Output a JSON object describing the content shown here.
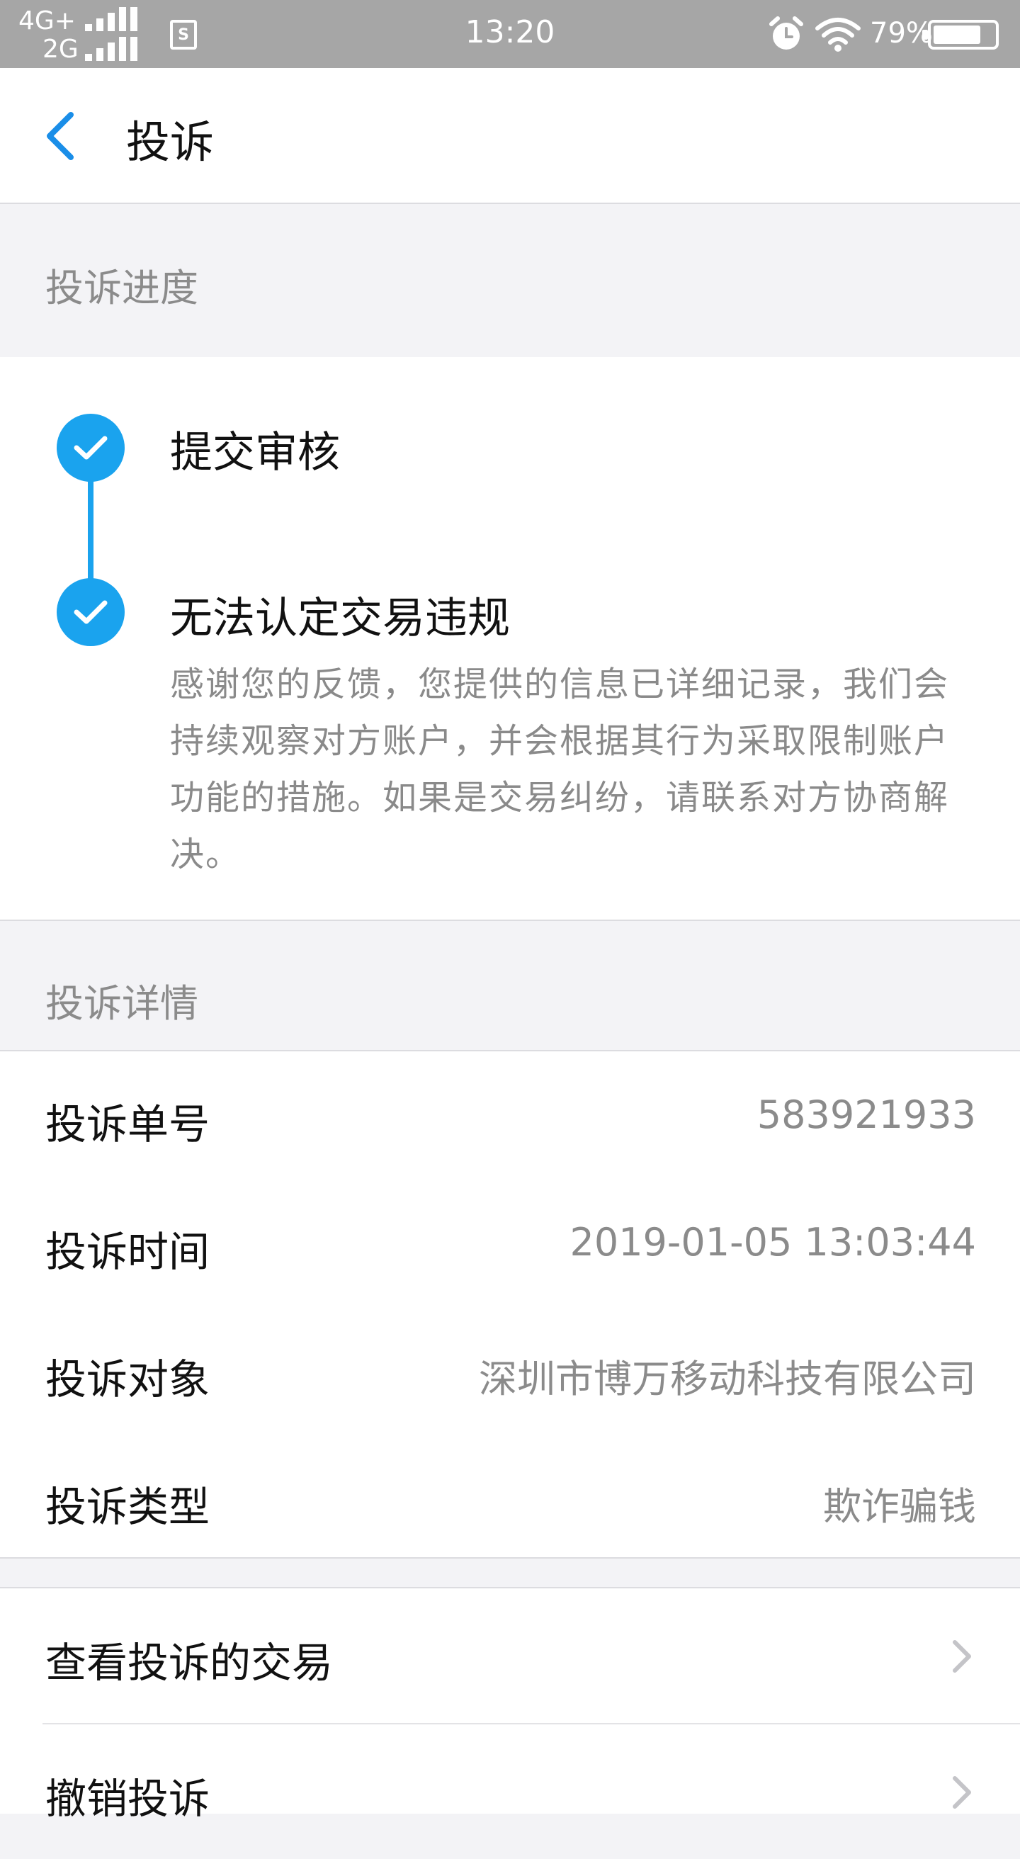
{
  "status_bar": {
    "network_1": "4G+",
    "network_2": "2G",
    "sim_icon": "sim-icon",
    "sim_label": "S",
    "time": "13:20",
    "battery_percent": "79%",
    "battery_level": 0.79,
    "icons": [
      "alarm-icon",
      "wifi-icon",
      "battery-icon",
      "signal-icon"
    ]
  },
  "header": {
    "title": "投诉",
    "back_icon": "chevron-left-icon",
    "accent_color": "#1a8ee8"
  },
  "progress": {
    "section_label": "投诉进度",
    "accent_color": "#1aa3ee",
    "steps": [
      {
        "title": "提交审核",
        "icon": "check-icon"
      },
      {
        "title": "无法认定交易违规",
        "icon": "check-icon",
        "description": "感谢您的反馈，您提供的信息已详细记录，我们会持续观察对方账户，并会根据其行为采取限制账户功能的措施。如果是交易纠纷，请联系对方协商解决。"
      }
    ]
  },
  "details": {
    "section_label": "投诉详情",
    "rows": [
      {
        "label": "投诉单号",
        "value": "583921933"
      },
      {
        "label": "投诉时间",
        "value": "2019-01-05 13:03:44"
      },
      {
        "label": "投诉对象",
        "value": "深圳市博万移动科技有限公司"
      },
      {
        "label": "投诉类型",
        "value": "欺诈骗钱"
      }
    ]
  },
  "actions": [
    {
      "label": "查看投诉的交易",
      "icon": "chevron-right-icon"
    },
    {
      "label": "撤销投诉",
      "icon": "chevron-right-icon"
    }
  ]
}
